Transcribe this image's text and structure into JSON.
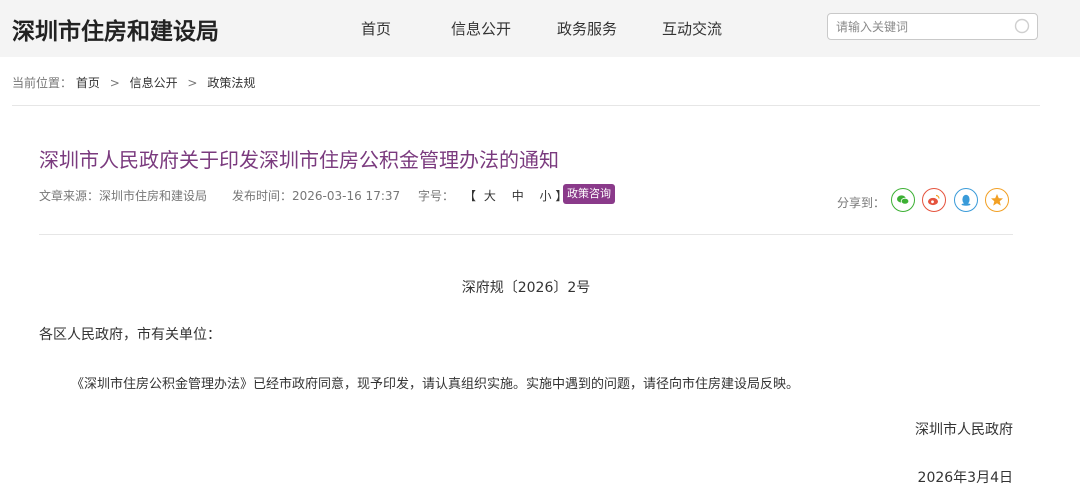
{
  "header": {
    "site_title": "深圳市住房和建设局",
    "nav": [
      "首页",
      "信息公开",
      "政务服务",
      "互动交流"
    ],
    "search_placeholder": "请输入关键词"
  },
  "breadcrumb": {
    "label": "当前位置：",
    "items": [
      "首页",
      "信息公开",
      "政策法规"
    ],
    "separator": ">"
  },
  "article": {
    "title": "深圳市人民政府关于印发深圳市住房公积金管理办法的通知",
    "source": "文章来源：深圳市住房和建设局",
    "publish_time": "发布时间：2026-03-16 17:37",
    "font_size_label": "字号：",
    "font_size_open": "【",
    "font_sizes": [
      "大",
      "中",
      "小"
    ],
    "font_size_close": "】",
    "badge": "政策咨询",
    "share_label": "分享到：",
    "share_icons": [
      "wechat-icon",
      "weibo-icon",
      "qq-icon",
      "qzone-icon"
    ],
    "doc_number": "深府规〔2026〕2号",
    "salutation": "各区人民政府，市有关单位：",
    "body": "《深圳市住房公积金管理办法》已经市政府同意，现予印发，请认真组织实施。实施中遇到的问题，请径向市住房建设局反映。",
    "signer": "深圳市人民政府",
    "date": "2026年3月4日"
  },
  "colors": {
    "title_purple": "#7a3a7e",
    "badge_purple": "#8a3a8a",
    "wechat_green": "#3cb034",
    "weibo_red": "#e5533d",
    "qq_blue": "#3a9bd9",
    "qzone_orange": "#f2a024"
  }
}
